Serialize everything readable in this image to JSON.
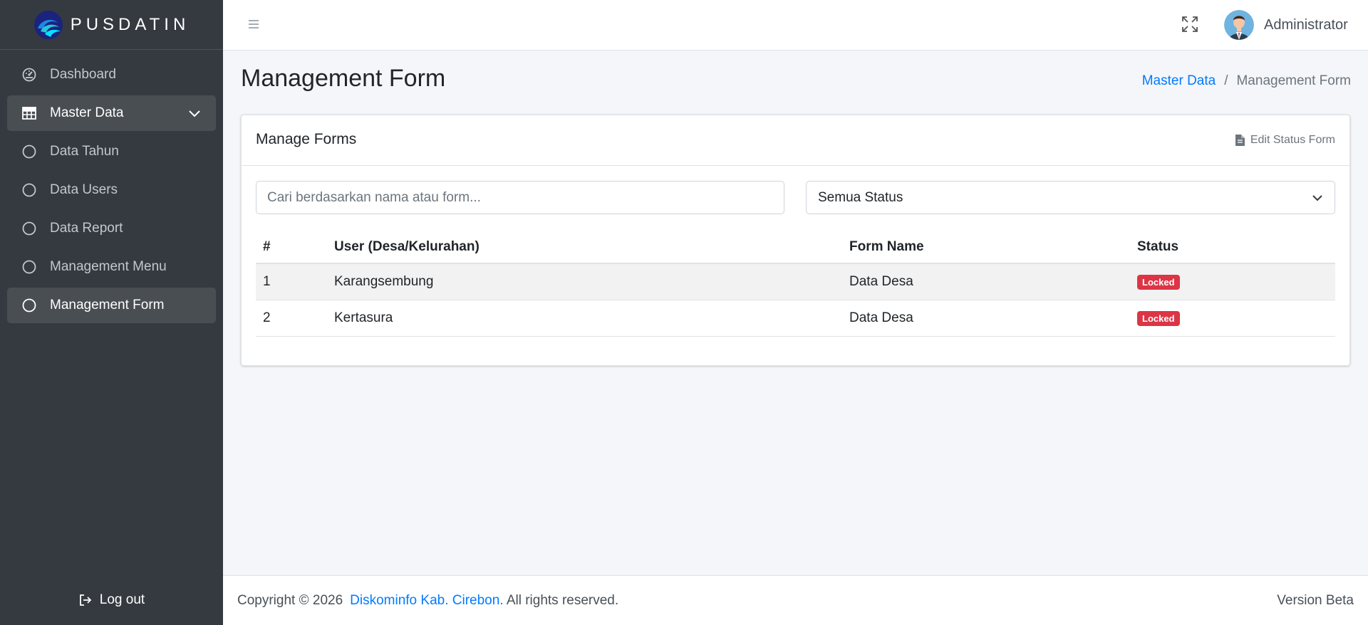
{
  "brand": {
    "name": "PUSDATIN"
  },
  "sidebar": {
    "items": [
      {
        "label": "Dashboard",
        "icon": "dashboard-gauge-icon"
      },
      {
        "label": "Master Data",
        "icon": "table-grid-icon",
        "expanded": true
      },
      {
        "label": "Data Tahun",
        "icon": "circle-icon"
      },
      {
        "label": "Data Users",
        "icon": "circle-icon"
      },
      {
        "label": "Data Report",
        "icon": "circle-icon"
      },
      {
        "label": "Management Menu",
        "icon": "circle-icon"
      },
      {
        "label": "Management Form",
        "icon": "circle-icon",
        "active": true
      }
    ],
    "logout_label": "Log out"
  },
  "topbar": {
    "user_name": "Administrator"
  },
  "page": {
    "title": "Management Form",
    "breadcrumb": {
      "parent": "Master Data",
      "separator": "/",
      "current": "Management Form"
    }
  },
  "card": {
    "title": "Manage Forms",
    "tool_label": "Edit Status Form",
    "search_placeholder": "Cari berdasarkan nama atau form...",
    "status_filter": {
      "selected": "Semua Status"
    },
    "table": {
      "headers": [
        "#",
        "User (Desa/Kelurahan)",
        "Form Name",
        "Status"
      ],
      "rows": [
        {
          "num": "1",
          "user": "Karangsembung",
          "form": "Data Desa",
          "status": "Locked"
        },
        {
          "num": "2",
          "user": "Kertasura",
          "form": "Data Desa",
          "status": "Locked"
        }
      ]
    }
  },
  "footer": {
    "copyright": "Copyright © 2026",
    "org": "Diskominfo Kab. Cirebon.",
    "rights": "All rights reserved.",
    "version": "Version Beta"
  },
  "colors": {
    "sidebar_bg": "#343a40",
    "link": "#007bff",
    "badge_danger": "#dc3545",
    "content_bg": "#f4f6f9"
  }
}
